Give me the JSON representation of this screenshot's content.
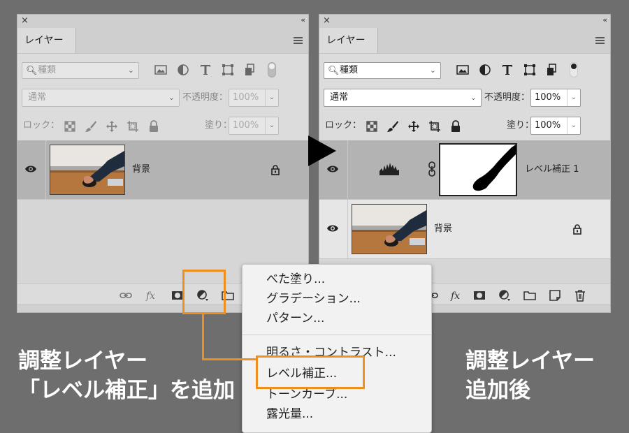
{
  "left_panel": {
    "close": "×",
    "collapse": "‹‹",
    "tab": "レイヤー",
    "kind_label": "種類",
    "blend_mode": "通常",
    "opacity_label": "不透明度：",
    "opacity_value": "100%",
    "lock_label": "ロック：",
    "fill_label": "塗り：",
    "fill_value": "100%",
    "layers": [
      {
        "name": "背景"
      }
    ]
  },
  "right_panel": {
    "close": "×",
    "collapse": "‹‹",
    "tab": "レイヤー",
    "kind_label": "種類",
    "blend_mode": "通常",
    "opacity_label": "不透明度：",
    "opacity_value": "100%",
    "lock_label": "ロック：",
    "fill_label": "塗り：",
    "fill_value": "100%",
    "layers": [
      {
        "name": "レベル補正 1"
      },
      {
        "name": "背景"
      }
    ]
  },
  "dropdown": {
    "items": [
      "べた塗り...",
      "グラデーション...",
      "パターン...",
      "明るさ・コントラスト...",
      "レベル補正...",
      "トーンカーブ...",
      "露光量..."
    ]
  },
  "captions": {
    "left_line1": "調整レイヤー",
    "left_line2": "「レベル補正」を追加",
    "right_line1": "調整レイヤー",
    "right_line2": "追加後"
  },
  "colors": {
    "highlight": "#f0901c",
    "background": "#6e6e6e"
  }
}
